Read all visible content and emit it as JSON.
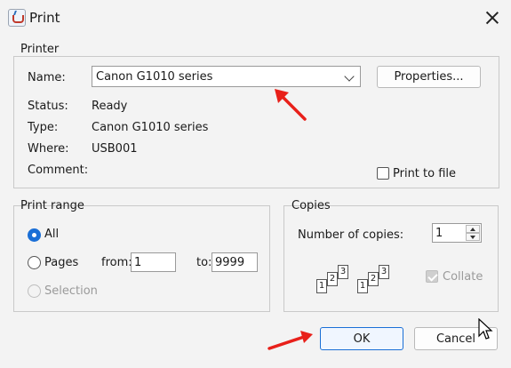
{
  "window": {
    "title": "Print"
  },
  "printer": {
    "group_title": "Printer",
    "name_label": "Name:",
    "name_value": "Canon G1010 series",
    "properties_button": "Properties...",
    "status_label": "Status:",
    "status_value": "Ready",
    "type_label": "Type:",
    "type_value": "Canon G1010 series",
    "where_label": "Where:",
    "where_value": "USB001",
    "comment_label": "Comment:",
    "print_to_file_label": "Print to file"
  },
  "print_range": {
    "group_title": "Print range",
    "all_label": "All",
    "pages_label": "Pages",
    "from_label": "from:",
    "from_value": "1",
    "to_label": "to:",
    "to_value": "9999",
    "selection_label": "Selection"
  },
  "copies": {
    "group_title": "Copies",
    "number_label": "Number of copies:",
    "number_value": "1",
    "collate_label": "Collate",
    "page_digits": [
      "1",
      "2",
      "3"
    ]
  },
  "buttons": {
    "ok": "OK",
    "cancel": "Cancel"
  },
  "annotations": {
    "arrow_color": "#e8201a",
    "accent": "#1a6fd6"
  }
}
